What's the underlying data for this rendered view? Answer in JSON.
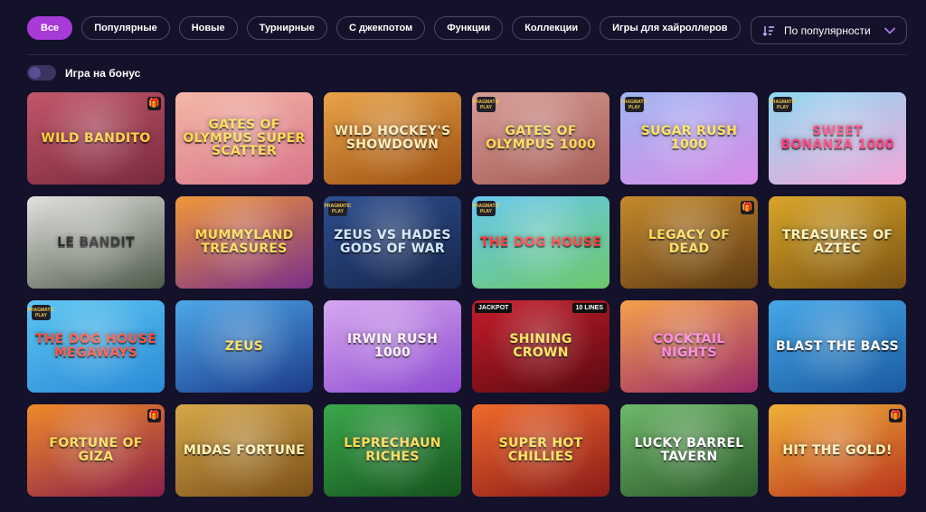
{
  "filters": [
    "Все",
    "Популярные",
    "Новые",
    "Турнирные",
    "С джекпотом",
    "Функции",
    "Коллекции",
    "Игры для хайроллеров"
  ],
  "active_filter_index": 0,
  "sort": {
    "label": "По популярности",
    "icon": "sort-lines-icon",
    "chevron": "chevron-down-icon"
  },
  "bonus_toggle": {
    "label": "Игра на бонус",
    "on": false
  },
  "accent_color": "#a83ad8",
  "games": [
    {
      "title": "Wild Bandito",
      "bg": [
        "#c2566a",
        "#7a2a3d"
      ],
      "color": "#ffcc33",
      "gift": true,
      "provider": false
    },
    {
      "title": "Gates of Olympus Super Scatter",
      "bg": [
        "#f3b8a6",
        "#d9748a"
      ],
      "color": "#ffd84a",
      "gift": false,
      "provider": false
    },
    {
      "title": "Wild Hockey's Showdown",
      "bg": [
        "#e9a347",
        "#9c4f12"
      ],
      "color": "#ffe9b0",
      "gift": false,
      "provider": false
    },
    {
      "title": "Gates of Olympus 1000",
      "bg": [
        "#d79d96",
        "#a45a55"
      ],
      "color": "#ffd84a",
      "gift": false,
      "provider": true
    },
    {
      "title": "Sugar Rush 1000",
      "bg": [
        "#9fb6f3",
        "#d78be6"
      ],
      "color": "#ffe04a",
      "gift": false,
      "provider": true
    },
    {
      "title": "Sweet Bonanza 1000",
      "bg": [
        "#8fd8f2",
        "#f3a6d8"
      ],
      "color": "#ff3a7a",
      "gift": false,
      "provider": true
    },
    {
      "title": "Le Bandit",
      "bg": [
        "#e2e2de",
        "#4e5a4a"
      ],
      "color": "#1a1a1a",
      "gift": false,
      "provider": false
    },
    {
      "title": "Mummyland Treasures",
      "bg": [
        "#f0973a",
        "#7a2f8a"
      ],
      "color": "#ffd84a",
      "gift": false,
      "provider": false
    },
    {
      "title": "Zeus vs Hades Gods of War",
      "bg": [
        "#2e4f8f",
        "#16254a"
      ],
      "color": "#cfe6ff",
      "gift": false,
      "provider": true
    },
    {
      "title": "The Dog House",
      "bg": [
        "#68c8ef",
        "#6cc86a"
      ],
      "color": "#ff3a3a",
      "gift": false,
      "provider": true
    },
    {
      "title": "Legacy of Dead",
      "bg": [
        "#c58a2c",
        "#5e3a14"
      ],
      "color": "#ffd84a",
      "gift": true,
      "provider": false
    },
    {
      "title": "Treasures of Aztec",
      "bg": [
        "#d8a52a",
        "#7a5212"
      ],
      "color": "#fff1b3",
      "gift": false,
      "provider": false
    },
    {
      "title": "The Dog House Megaways",
      "bg": [
        "#5bc6f2",
        "#2a8ad6"
      ],
      "color": "#ff4e3a",
      "gift": false,
      "provider": true
    },
    {
      "title": "Zeus",
      "bg": [
        "#4ea8e8",
        "#1c3a8a"
      ],
      "color": "#ffd84a",
      "gift": false,
      "provider": false
    },
    {
      "title": "Irwin Rush 1000",
      "bg": [
        "#d6a8f0",
        "#8e4ad0"
      ],
      "color": "#fff1ff",
      "gift": false,
      "provider": false
    },
    {
      "title": "Shining Crown",
      "bg": [
        "#c61c2a",
        "#5a0a12"
      ],
      "color": "#ffe04a",
      "gift": false,
      "provider": false,
      "tag_left": "JACKPOT",
      "tag_right": "10 LINES"
    },
    {
      "title": "Cocktail Nights",
      "bg": [
        "#f5a14a",
        "#9a2a6a"
      ],
      "color": "#ff7ad8",
      "gift": false,
      "provider": false
    },
    {
      "title": "Blast the Bass",
      "bg": [
        "#46a8e8",
        "#1a5aa0"
      ],
      "color": "#ffffff",
      "gift": false,
      "provider": false
    },
    {
      "title": "Fortune of Giza",
      "bg": [
        "#f08a2a",
        "#8a1e4a"
      ],
      "color": "#ffd84a",
      "gift": true,
      "provider": false
    },
    {
      "title": "Midas Fortune",
      "bg": [
        "#d6a84a",
        "#7a4f18"
      ],
      "color": "#fff1b3",
      "gift": false,
      "provider": false
    },
    {
      "title": "Leprechaun Riches",
      "bg": [
        "#3aa84a",
        "#16521e"
      ],
      "color": "#ffd84a",
      "gift": false,
      "provider": false
    },
    {
      "title": "Super Hot Chillies",
      "bg": [
        "#f06a2a",
        "#8a1a1a"
      ],
      "color": "#ffe04a",
      "gift": false,
      "provider": false
    },
    {
      "title": "Lucky Barrel Tavern",
      "bg": [
        "#6fb86a",
        "#2a5a2a"
      ],
      "color": "#ffffff",
      "gift": false,
      "provider": false
    },
    {
      "title": "Hit the Gold!",
      "bg": [
        "#f0b03a",
        "#b8341c"
      ],
      "color": "#fff1b3",
      "gift": true,
      "provider": false
    }
  ],
  "provider_badge_text": "PRAGMATIC PLAY",
  "gift_icon_glyph": "🎁"
}
